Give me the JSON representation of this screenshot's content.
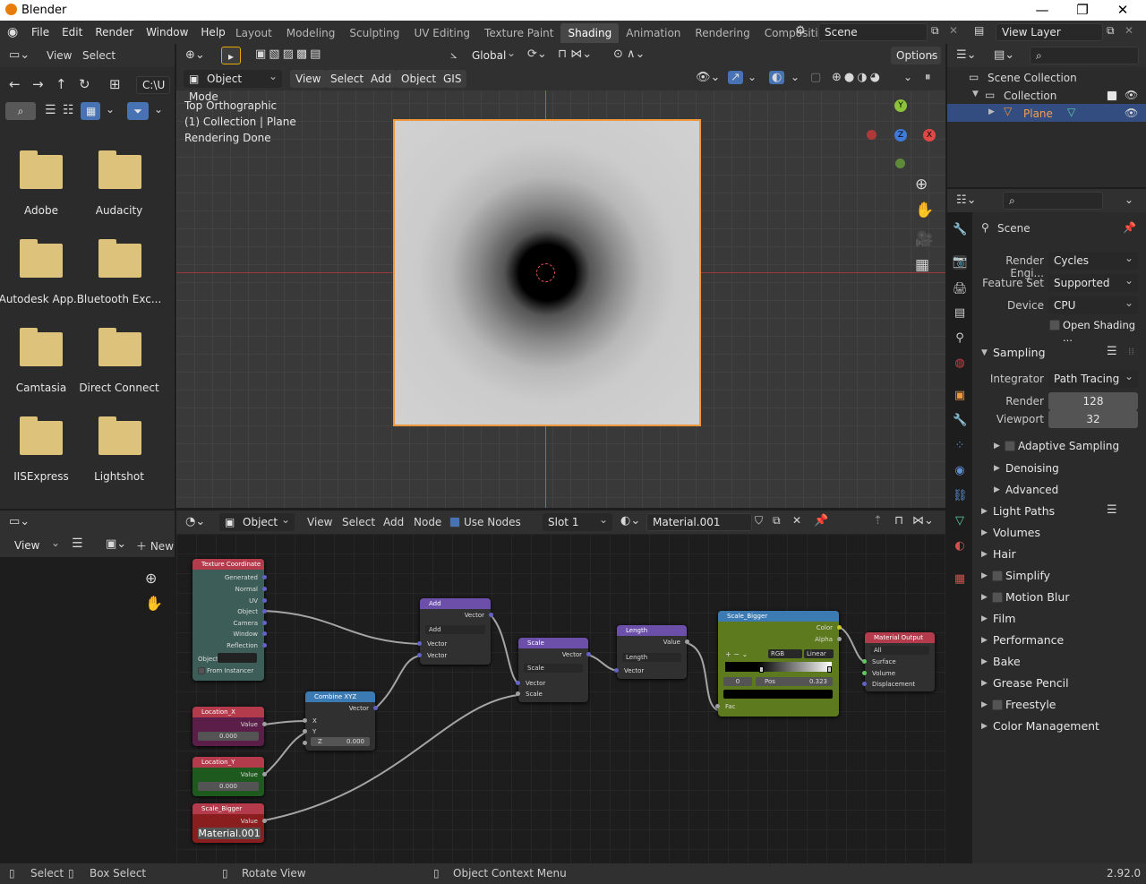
{
  "app": {
    "title": "Blender",
    "version": "2.92.0"
  },
  "menu": [
    "File",
    "Edit",
    "Render",
    "Window",
    "Help"
  ],
  "workspaces": [
    "Layout",
    "Modeling",
    "Sculpting",
    "UV Editing",
    "Texture Paint",
    "Shading",
    "Animation",
    "Rendering",
    "Compositing"
  ],
  "active_workspace": "Shading",
  "scene": "Scene",
  "view_layer": "View Layer",
  "filebrowser": {
    "menu": [
      "View",
      "Select"
    ],
    "path": "C:\\U",
    "folders": [
      "Adobe",
      "Audacity",
      "Autodesk App...",
      "Bluetooth Exc...",
      "Camtasia",
      "Direct Connect",
      "IISExpress",
      "Lightshot"
    ]
  },
  "viewport": {
    "orientation": "Global",
    "mode": "Object Mode",
    "menu": [
      "View",
      "Select",
      "Add",
      "Object",
      "GIS"
    ],
    "options": "Options",
    "overlay_lines": [
      "Top Orthographic",
      "(1) Collection | Plane",
      "Rendering Done"
    ]
  },
  "image_editor": {
    "view": "View",
    "new": "New"
  },
  "node_editor": {
    "type": "Object",
    "menu": [
      "View",
      "Select",
      "Add",
      "Node"
    ],
    "use_nodes": "Use Nodes",
    "slot": "Slot 1",
    "material": "Material.001",
    "nodes": {
      "texcoord": {
        "title": "Texture Coordinate",
        "outputs": [
          "Generated",
          "Normal",
          "UV",
          "Object",
          "Camera",
          "Window",
          "Reflection"
        ],
        "object_label": "Object",
        "from_instancer": "From Instancer"
      },
      "locx": {
        "title": "Location_X",
        "out": "Value",
        "val": "0.000"
      },
      "locy": {
        "title": "Location_Y",
        "out": "Value",
        "val": "0.000"
      },
      "scalebig": {
        "title": "Scale_Bigger",
        "out": "Value",
        "val": "Material.001"
      },
      "combine": {
        "title": "Combine XYZ",
        "out": "Vector",
        "x": "X",
        "y": "Y",
        "z": "Z",
        "zval": "0.000"
      },
      "add": {
        "title": "Add",
        "out": "Vector",
        "op": "Add",
        "in1": "Vector",
        "in2": "Vector"
      },
      "scale": {
        "title": "Scale",
        "out": "Vector",
        "op": "Scale",
        "in1": "Vector",
        "in2": "Scale"
      },
      "length": {
        "title": "Length",
        "out": "Value",
        "op": "Length",
        "in1": "Vector"
      },
      "ramp": {
        "title": "Scale_Bigger",
        "out1": "Color",
        "out2": "Alpha",
        "mode": "RGB",
        "interp": "Linear",
        "idx": "0",
        "pos_label": "Pos",
        "pos": "0.323",
        "fac": "Fac"
      },
      "output": {
        "title": "Material Output",
        "target": "All",
        "in": [
          "Surface",
          "Volume",
          "Displacement"
        ]
      }
    }
  },
  "outliner": {
    "items": [
      {
        "label": "Scene Collection"
      },
      {
        "label": "Collection"
      },
      {
        "label": "Plane"
      }
    ]
  },
  "properties": {
    "context": "Scene",
    "rows": [
      {
        "label": "Render Engi...",
        "value": "Cycles"
      },
      {
        "label": "Feature Set",
        "value": "Supported"
      },
      {
        "label": "Device",
        "value": "CPU"
      }
    ],
    "open_shading": "Open Shading ...",
    "sampling": {
      "title": "Sampling",
      "integrator_label": "Integrator",
      "integrator": "Path Tracing",
      "render_label": "Render",
      "render": "128",
      "viewport_label": "Viewport",
      "viewport": "32",
      "subs": [
        "Adaptive Sampling",
        "Denoising",
        "Advanced"
      ]
    },
    "sections": [
      "Light Paths",
      "Volumes",
      "Hair",
      "Simplify",
      "Motion Blur",
      "Film",
      "Performance",
      "Bake",
      "Grease Pencil",
      "Freestyle",
      "Color Management"
    ]
  },
  "status": {
    "select": "Select",
    "box_select": "Box Select",
    "rotate": "Rotate View",
    "context_menu": "Object Context Menu"
  }
}
